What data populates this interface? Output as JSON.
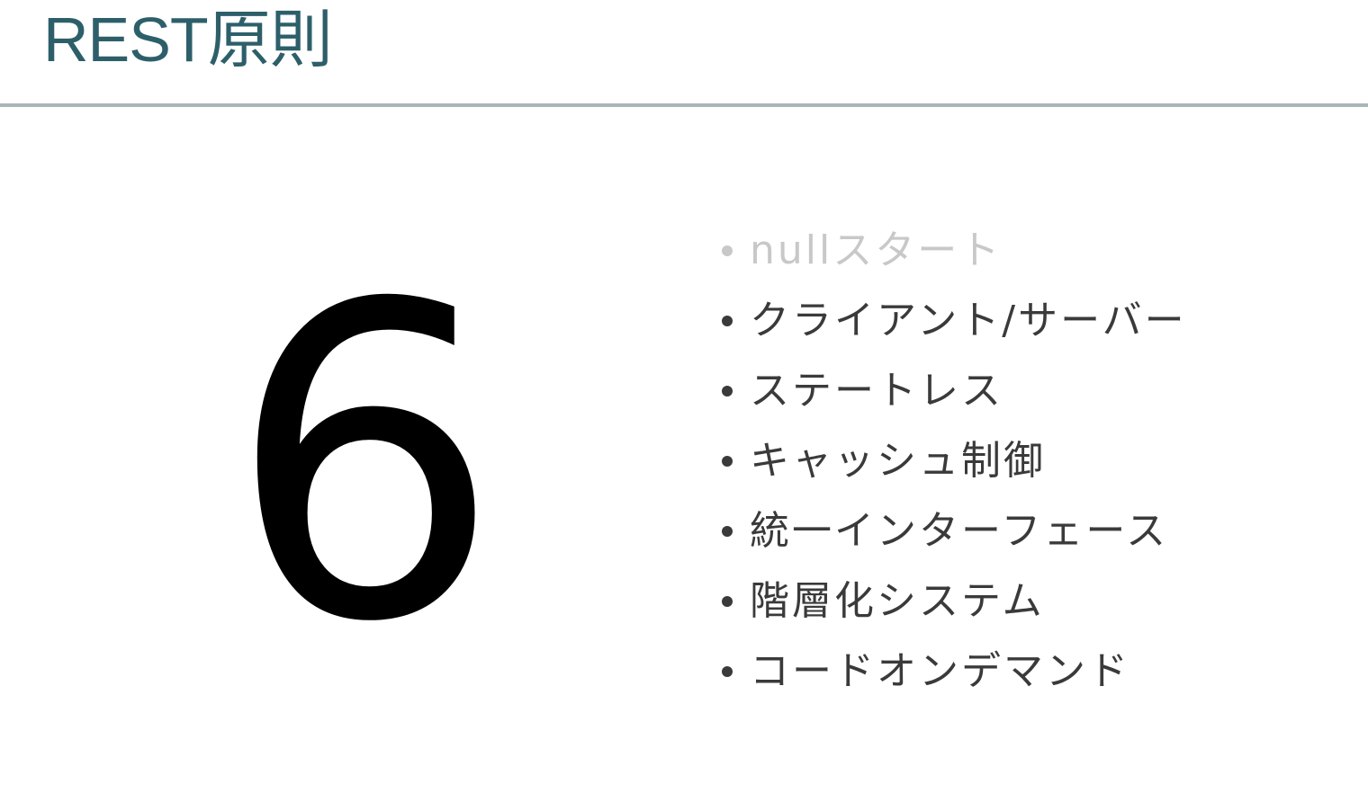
{
  "slide": {
    "title": "REST原則",
    "big_number": "6",
    "title_color": "#2d5f6a",
    "rule_color": "#a9b6b5"
  },
  "principles": [
    {
      "label": "nullスタート",
      "faded": true
    },
    {
      "label": "クライアント/サーバー",
      "faded": false
    },
    {
      "label": "ステートレス",
      "faded": false
    },
    {
      "label": "キャッシュ制御",
      "faded": false
    },
    {
      "label": "統一インターフェース",
      "faded": false
    },
    {
      "label": "階層化システム",
      "faded": false
    },
    {
      "label": "コードオンデマンド",
      "faded": false
    }
  ]
}
